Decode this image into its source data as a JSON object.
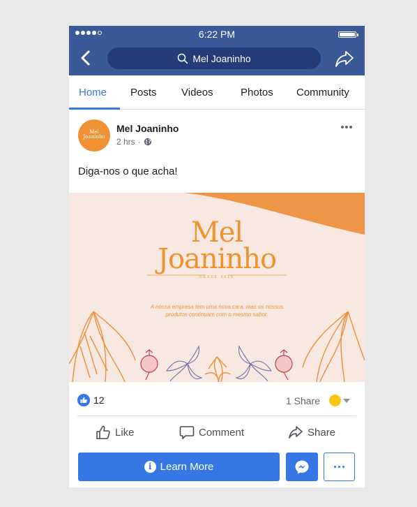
{
  "status_bar": {
    "time": "6:22 PM",
    "signal_filled": 4,
    "signal_total": 5,
    "battery_level": 1.0
  },
  "header": {
    "search_text": "Mel Joaninho",
    "back_icon": "chevron-left-icon",
    "share_icon": "share-arrow-icon"
  },
  "tabs": [
    {
      "label": "Home",
      "active": true
    },
    {
      "label": "Posts",
      "active": false
    },
    {
      "label": "Videos",
      "active": false
    },
    {
      "label": "Photos",
      "active": false
    },
    {
      "label": "Community",
      "active": false
    }
  ],
  "post": {
    "page_name": "Mel Joaninho",
    "time_ago": "2 hrs",
    "separator": "·",
    "privacy_icon": "globe-icon",
    "avatar_text_1": "Mel",
    "avatar_text_2": "Joaninho",
    "text": "Diga-nos o que acha!",
    "image": {
      "logo_line1": "Mel",
      "logo_line2": "Joaninho",
      "logo_sub": "DESDE 2015",
      "tagline": "A nossa empresa tem uma nova cara, mas os nossos produtos continuam com o mesmo sabor."
    }
  },
  "reactions": {
    "like_count": "12",
    "share_text": "1 Share"
  },
  "actions": {
    "like": "Like",
    "comment": "Comment",
    "share": "Share"
  },
  "cta": {
    "learn_more": "Learn More",
    "info_glyph": "i"
  },
  "colors": {
    "facebook_blue": "#3b5998",
    "search_bg": "#253c78",
    "accent_blue": "#3578e5",
    "brand_orange": "#f0922f",
    "image_bg": "#f7e9e2"
  }
}
